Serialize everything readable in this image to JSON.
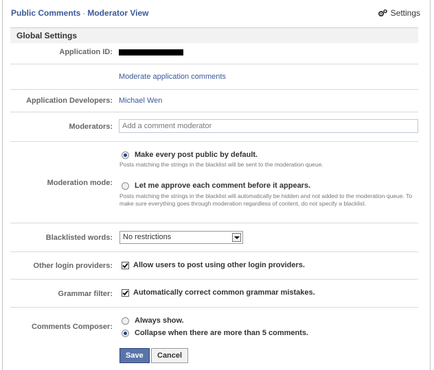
{
  "header": {
    "title": "Public Comments",
    "subtitle": "Moderator View",
    "separator": "·",
    "settings_label": "Settings",
    "settings_icon": "gears-icon"
  },
  "section": {
    "title": "Global Settings"
  },
  "fields": {
    "application_id": {
      "label": "Application ID:",
      "value_redacted": true
    },
    "moderate_link": "Moderate application comments",
    "developers": {
      "label": "Application Developers:",
      "value": "Michael Wen"
    },
    "moderators": {
      "label": "Moderators:",
      "placeholder": "Add a comment moderator"
    },
    "moderation_mode": {
      "label": "Moderation mode:",
      "options": [
        {
          "label": "Make every post public by default.",
          "hint": "Posts matching the strings in the blacklist will be sent to the moderation queue.",
          "selected": true
        },
        {
          "label": "Let me approve each comment before it appears.",
          "hint": "Posts matching the strings in the blacklist will automatically be hidden and not added to the moderation queue. To make sure everything goes through moderation regardless of content, do not specify a blacklist.",
          "selected": false
        }
      ]
    },
    "blacklist": {
      "label": "Blacklisted words:",
      "selected": "No restrictions"
    },
    "other_login": {
      "label": "Other login providers:",
      "checkbox_label": "Allow users to post using other login providers.",
      "checked": true
    },
    "grammar": {
      "label": "Grammar filter:",
      "checkbox_label": "Automatically correct common grammar mistakes.",
      "checked": true
    },
    "composer": {
      "label": "Comments Composer:",
      "options": [
        {
          "label": "Always show.",
          "selected": false
        },
        {
          "label": "Collapse when there are more than 5 comments.",
          "selected": true
        }
      ]
    }
  },
  "buttons": {
    "save": "Save",
    "cancel": "Cancel"
  }
}
